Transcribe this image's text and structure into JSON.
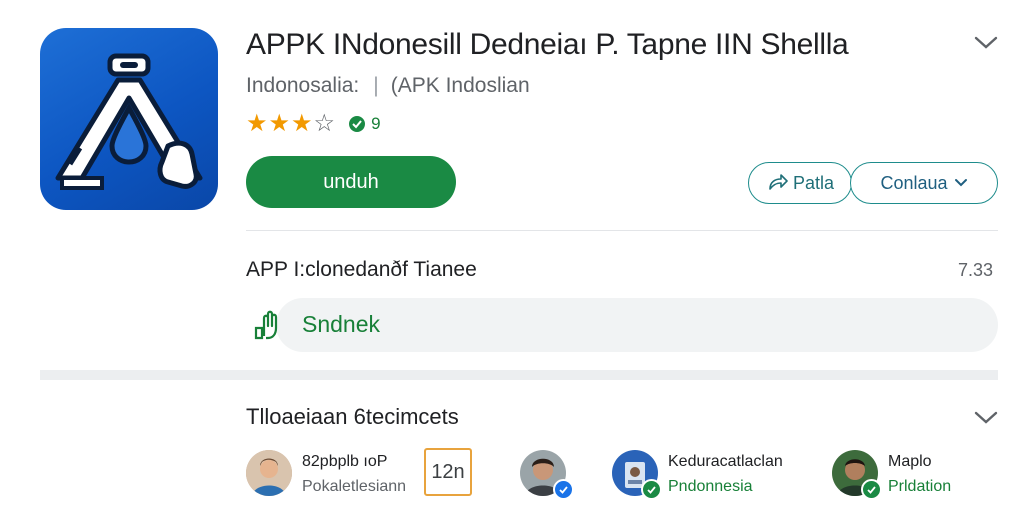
{
  "app": {
    "title": "APPK INdonesill Dedneiaı P. Tapne IIN Shellla",
    "developer": "Indonosalia:",
    "category": "(APK Indoslian",
    "separator": "|",
    "rating_stars": 3.5,
    "rating_count": "9"
  },
  "actions": {
    "install_label": "unduh",
    "share_label": "Patla",
    "more_label": "Conlaua"
  },
  "section1": {
    "title": "APP I:clonedanðf Tianee",
    "count": "7.33",
    "action_label": "Sndnek"
  },
  "section2": {
    "title": "Tlloaeiaan 6tecimcets",
    "items": [
      {
        "name": "82pbplb ıoP",
        "subtitle": "Pokaletlesiann"
      },
      {
        "tile_text": "12n"
      },
      {
        "name": "",
        "subtitle": ""
      },
      {
        "name": "Keduracatlaclan",
        "subtitle": "Pndonnesia"
      },
      {
        "name": "Maplo",
        "subtitle": "Prldation"
      }
    ]
  },
  "colors": {
    "accent_green": "#1a8a44",
    "teal_outline": "#1e8c8c",
    "icon_blue": "#0d56c2",
    "star": "#f29900"
  },
  "icons": [
    "app-logo-icon",
    "chevron-down-icon",
    "star-icon",
    "shield-check-icon",
    "share-icon",
    "hand-touch-icon",
    "verified-icon"
  ]
}
